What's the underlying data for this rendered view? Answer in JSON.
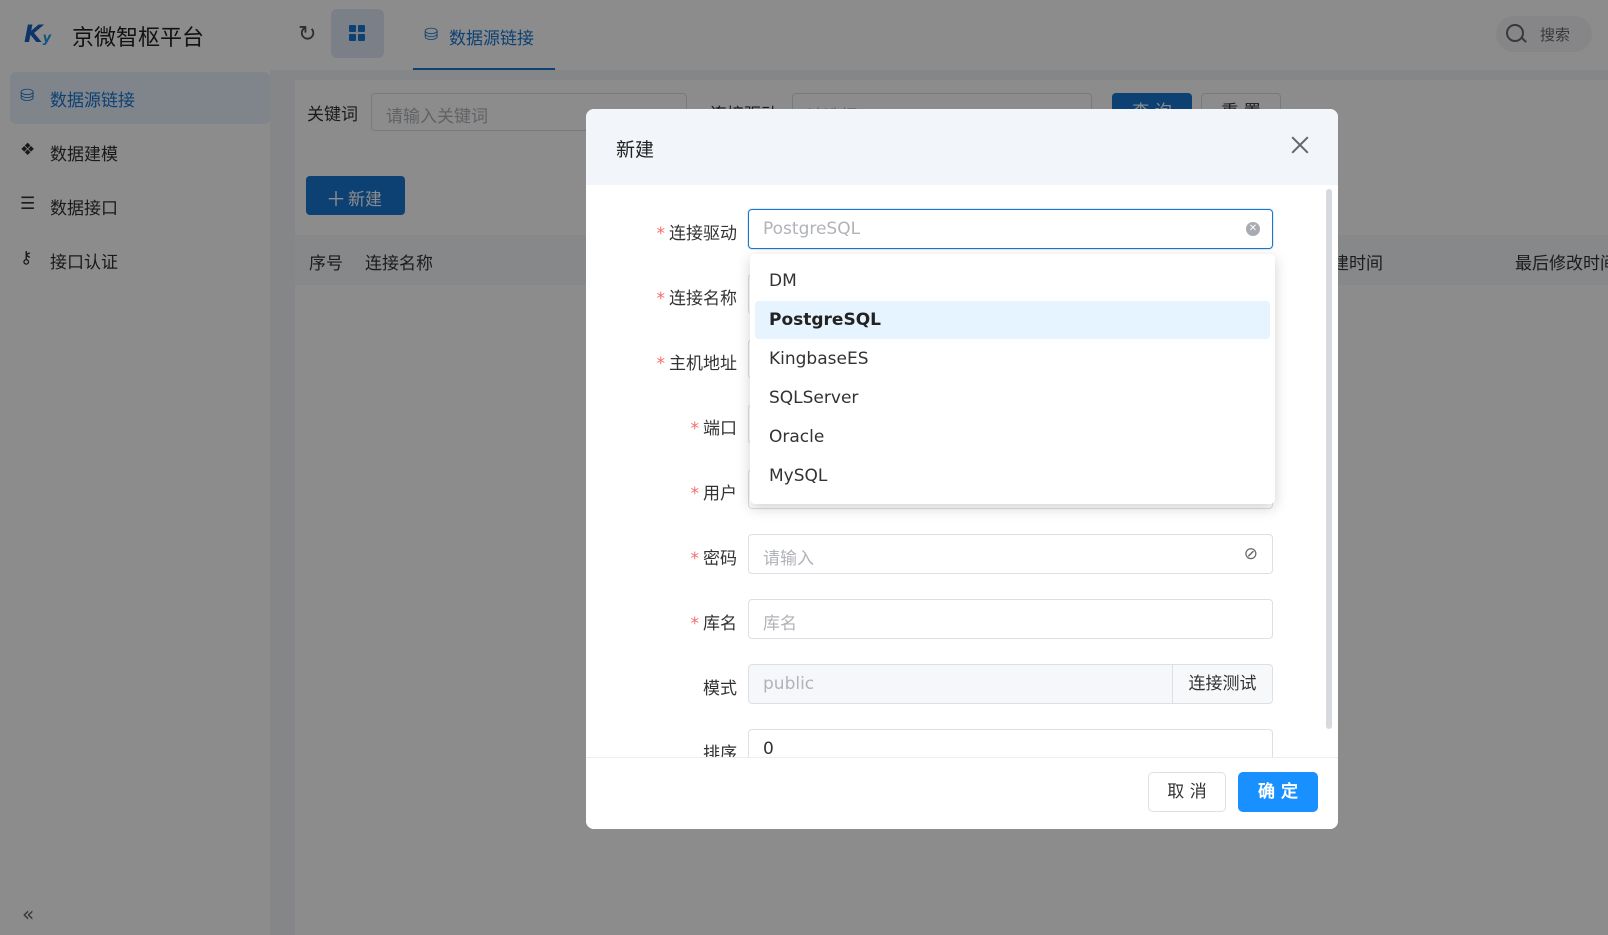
{
  "app": {
    "logo": "K",
    "logo_sub": "y",
    "title": "京微智枢平台"
  },
  "header": {
    "refresh_icon": "↻",
    "tab_label": "数据源链接",
    "search_label": "搜索"
  },
  "sidebar": {
    "items": [
      {
        "icon": "⛁",
        "label": "数据源链接"
      },
      {
        "icon": "❖",
        "label": "数据建模"
      },
      {
        "icon": "☰",
        "label": "数据接口"
      },
      {
        "icon": "⚷",
        "label": "接口认证"
      }
    ],
    "collapse_icon": "«"
  },
  "toolbar": {
    "keyword_label": "关键词",
    "keyword_placeholder": "请输入关键词",
    "driver_label": "连接驱动",
    "driver_placeholder": "请选择",
    "query_label": "查 询",
    "reset_label": "重 置",
    "new_label": "新建",
    "new_icon": "＋"
  },
  "table": {
    "columns": [
      "序号",
      "连接名称",
      "创建时间",
      "最后修改时间"
    ]
  },
  "dialog": {
    "title": "新建",
    "fields": {
      "driver": {
        "label": "连接驱动",
        "placeholder": "PostgreSQL"
      },
      "name": {
        "label": "连接名称"
      },
      "host": {
        "label": "主机地址"
      },
      "port": {
        "label": "端口"
      },
      "user": {
        "label": "用户"
      },
      "password": {
        "label": "密码",
        "placeholder": "请输入"
      },
      "database": {
        "label": "库名",
        "placeholder": "库名"
      },
      "schema": {
        "label": "模式",
        "placeholder": "public",
        "append": "连接测试"
      },
      "sort": {
        "label": "排序",
        "value": "0"
      }
    },
    "required_mark": "*",
    "cancel_label": "取 消",
    "ok_label": "确 定",
    "clear_icon": "✕",
    "eye_icon": "⊘"
  },
  "dropdown": {
    "options": [
      "DM",
      "PostgreSQL",
      "KingbaseES",
      "SQLServer",
      "Oracle",
      "MySQL"
    ],
    "selected": "PostgreSQL"
  },
  "colors": {
    "primary": "#1976d2",
    "ok_button": "#1890ff",
    "required": "#f56c6c",
    "option_selected_bg": "#e6f4ff"
  }
}
